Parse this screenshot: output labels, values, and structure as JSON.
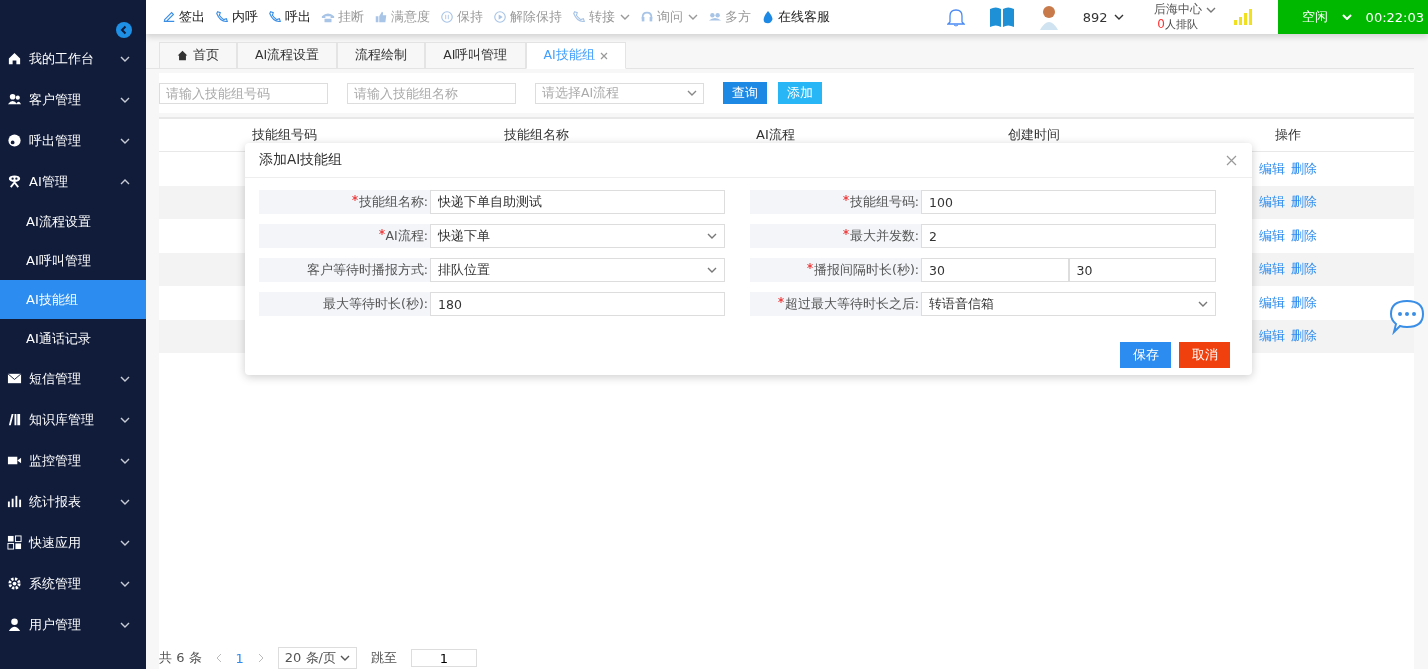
{
  "sidebar": {
    "items": [
      {
        "label": "我的工作台",
        "expanded": false
      },
      {
        "label": "客户管理",
        "expanded": false
      },
      {
        "label": "呼出管理",
        "expanded": false
      },
      {
        "label": "AI管理",
        "expanded": true,
        "children": [
          {
            "label": "AI流程设置",
            "selected": false
          },
          {
            "label": "AI呼叫管理",
            "selected": false
          },
          {
            "label": "AI技能组",
            "selected": true
          },
          {
            "label": "AI通话记录",
            "selected": false
          }
        ]
      },
      {
        "label": "短信管理",
        "expanded": false
      },
      {
        "label": "知识库管理",
        "expanded": false
      },
      {
        "label": "监控管理",
        "expanded": false
      },
      {
        "label": "统计报表",
        "expanded": false
      },
      {
        "label": "快速应用",
        "expanded": false
      },
      {
        "label": "系统管理",
        "expanded": false
      },
      {
        "label": "用户管理",
        "expanded": false
      }
    ]
  },
  "toolbar": {
    "actions": [
      {
        "label": "签出",
        "disabled": false,
        "dropdown": false
      },
      {
        "label": "内呼",
        "disabled": false,
        "dropdown": false
      },
      {
        "label": "呼出",
        "disabled": false,
        "dropdown": false
      },
      {
        "label": "挂断",
        "disabled": true,
        "dropdown": false
      },
      {
        "label": "满意度",
        "disabled": true,
        "dropdown": false
      },
      {
        "label": "保持",
        "disabled": true,
        "dropdown": false
      },
      {
        "label": "解除保持",
        "disabled": true,
        "dropdown": false
      },
      {
        "label": "转接",
        "disabled": true,
        "dropdown": true
      },
      {
        "label": "询问",
        "disabled": true,
        "dropdown": true
      },
      {
        "label": "多方",
        "disabled": true,
        "dropdown": false
      },
      {
        "label": "在线客服",
        "disabled": false,
        "dropdown": false
      }
    ],
    "extension": "892",
    "center": "后海中心",
    "queue_count": "0",
    "queue_label": "人排队",
    "status": "空闲",
    "timer": "00:22:03"
  },
  "tabs": [
    {
      "label": "首页",
      "selected": false,
      "closable": false
    },
    {
      "label": "AI流程设置",
      "selected": false,
      "closable": false
    },
    {
      "label": "流程绘制",
      "selected": false,
      "closable": false
    },
    {
      "label": "AI呼叫管理",
      "selected": false,
      "closable": false
    },
    {
      "label": "AI技能组",
      "selected": true,
      "closable": true
    }
  ],
  "filters": {
    "fields": [
      {
        "kind": "input",
        "placeholder": "请输入技能组号码"
      },
      {
        "kind": "input",
        "placeholder": "请输入技能组名称"
      },
      {
        "kind": "select",
        "placeholder": "请选择AI流程"
      }
    ],
    "buttons": [
      "查询",
      "添加"
    ]
  },
  "table": {
    "columns": [
      "技能组号码",
      "技能组名称",
      "AI流程",
      "创建时间",
      "操作"
    ],
    "rows": [
      {
        "actions": [
          "编辑",
          "删除"
        ]
      },
      {
        "actions": [
          "编辑",
          "删除"
        ]
      },
      {
        "actions": [
          "编辑",
          "删除"
        ]
      },
      {
        "actions": [
          "编辑",
          "删除"
        ]
      },
      {
        "actions": [
          "编辑",
          "删除"
        ]
      },
      {
        "actions": [
          "编辑",
          "删除"
        ]
      }
    ]
  },
  "pagination": {
    "total": "共 6 条",
    "page": "1",
    "page_size": "20 条/页",
    "jump_label": "跳至",
    "jump_value": "1"
  },
  "modal": {
    "title": "添加AI技能组",
    "fields": [
      {
        "label": "技能组名称:",
        "required": true,
        "kind": "input",
        "values": [
          "快递下单自助测试"
        ]
      },
      {
        "label": "技能组号码:",
        "required": true,
        "kind": "input",
        "values": [
          "100"
        ]
      },
      {
        "label": "AI流程:",
        "required": true,
        "kind": "select",
        "values": [
          "快递下单"
        ]
      },
      {
        "label": "最大并发数:",
        "required": true,
        "kind": "input",
        "values": [
          "2"
        ]
      },
      {
        "label": "客户等待时播报方式:",
        "required": false,
        "kind": "select",
        "values": [
          "排队位置"
        ]
      },
      {
        "label": "播报间隔时长(秒):",
        "required": true,
        "kind": "pair",
        "values": [
          "30",
          "30"
        ]
      },
      {
        "label": "最大等待时长(秒):",
        "required": false,
        "kind": "input",
        "values": [
          "180"
        ]
      },
      {
        "label": "超过最大等待时长之后:",
        "required": true,
        "kind": "select",
        "values": [
          "转语音信箱"
        ]
      }
    ],
    "buttons": [
      {
        "label": "保存",
        "kind": "primary"
      },
      {
        "label": "取消",
        "kind": "danger"
      }
    ]
  }
}
